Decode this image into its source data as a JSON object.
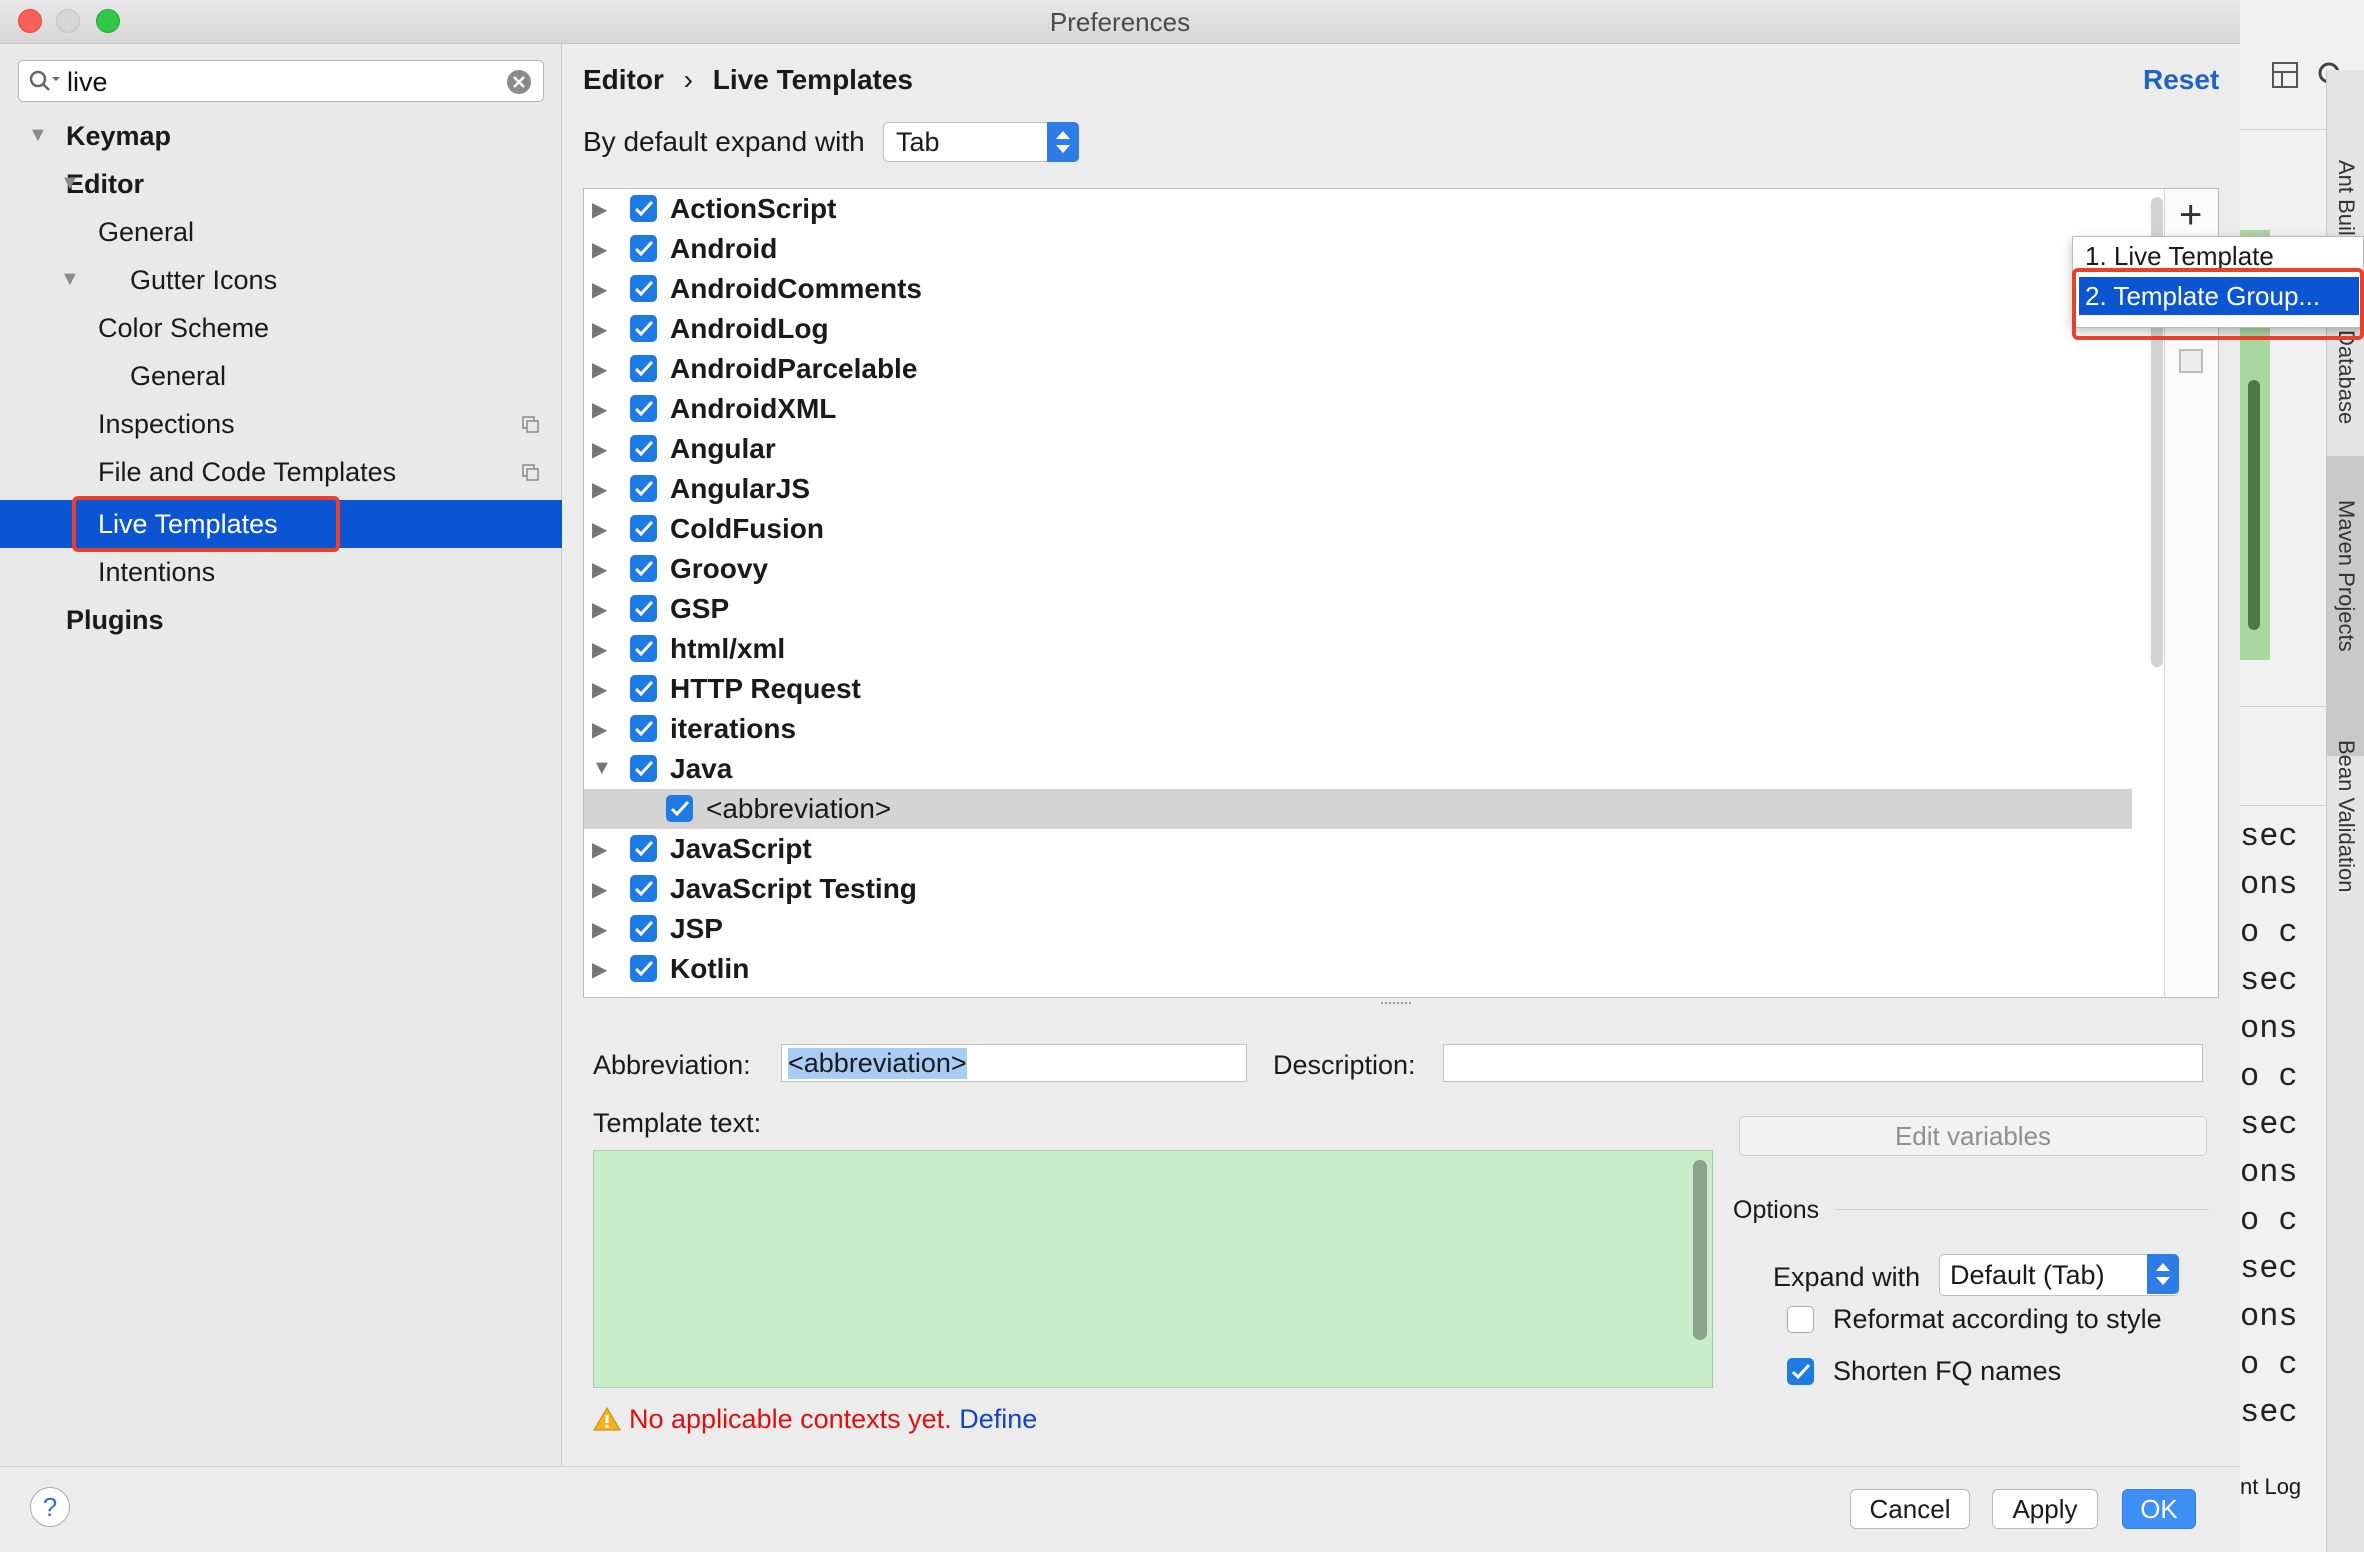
{
  "window": {
    "title": "Preferences"
  },
  "search": {
    "value": "live"
  },
  "sidebar": {
    "items": [
      {
        "label": "Keymap"
      },
      {
        "label": "Editor"
      },
      {
        "label": "General"
      },
      {
        "label": "Gutter Icons"
      },
      {
        "label": "Color Scheme"
      },
      {
        "label": "General"
      },
      {
        "label": "Inspections"
      },
      {
        "label": "File and Code Templates"
      },
      {
        "label": "Live Templates"
      },
      {
        "label": "Intentions"
      },
      {
        "label": "Plugins"
      }
    ]
  },
  "header": {
    "breadcrumb_parent": "Editor",
    "breadcrumb_sep": "›",
    "breadcrumb_current": "Live Templates",
    "reset": "Reset"
  },
  "expand": {
    "label": "By default expand with",
    "value": "Tab"
  },
  "tree": {
    "groups": [
      "ActionScript",
      "Android",
      "AndroidComments",
      "AndroidLog",
      "AndroidParcelable",
      "AndroidXML",
      "Angular",
      "AngularJS",
      "ColdFusion",
      "Groovy",
      "GSP",
      "html/xml",
      "HTTP Request",
      "iterations",
      "Java",
      "<abbreviation>",
      "JavaScript",
      "JavaScript Testing",
      "JSP",
      "Kotlin"
    ]
  },
  "popup": {
    "item1": "1. Live Template",
    "item2": "2. Template Group..."
  },
  "form": {
    "abbreviation_label": "Abbreviation:",
    "abbreviation_value": "<abbreviation>",
    "description_label": "Description:",
    "template_text_label": "Template text:",
    "edit_variables": "Edit variables",
    "options_label": "Options",
    "expand_with_label": "Expand with",
    "expand_with_value": "Default (Tab)",
    "reformat_label": "Reformat according to style",
    "shorten_label": "Shorten FQ names",
    "warning": "No applicable contexts yet.",
    "define": "Define"
  },
  "footer": {
    "help": "?",
    "cancel": "Cancel",
    "apply": "Apply",
    "ok": "OK"
  },
  "ide": {
    "ant_build": "Ant Buil",
    "database": "Database",
    "maven": "Maven Projects",
    "bean": "Bean Validation",
    "event_log": "nt Log",
    "code_lines": [
      "sec",
      "ons",
      "o c",
      "sec",
      "ons",
      "o c",
      "sec",
      "ons",
      "o c",
      "sec",
      "ons",
      "o c",
      "sec"
    ]
  }
}
